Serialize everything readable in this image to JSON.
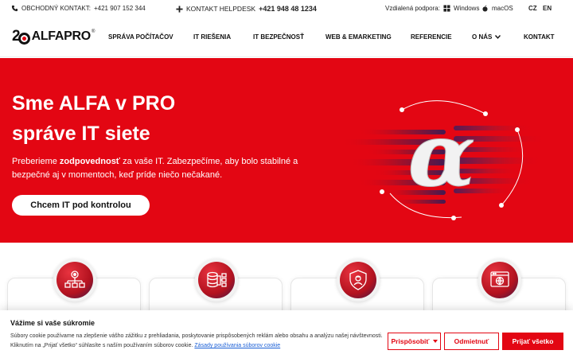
{
  "topbar": {
    "sales_label": "OBCHODNÝ KONTAKT:",
    "sales_phone": "+421 907 152 344",
    "helpdesk_label": "KONTAKT HELPDESK",
    "helpdesk_phone": "+421 948 48 1234",
    "remote_label": "Vzdialená podpora:",
    "windows": "Windows",
    "macos": "macOS",
    "lang_cz": "CZ",
    "lang_en": "EN"
  },
  "logo": {
    "number": "2",
    "brand": "ALFAPRO",
    "reg": "®"
  },
  "nav": {
    "items": [
      "SPRÁVA POČÍTAČOV",
      "IT RIEŠENIA",
      "IT BEZPEČNOSŤ",
      "WEB & EMARKETING",
      "REFERENCIE",
      "O NÁS",
      "KONTAKT"
    ]
  },
  "hero": {
    "title_line1": "Sme ALFA v PRO",
    "title_line2": "správe IT siete",
    "lead_pre": "Preberieme ",
    "lead_bold": "zodpovednosť",
    "lead_post": " za vaše IT. Zabezpečíme, aby bolo stabilné a bezpečné aj v momentoch, keď príde niečo nečakané.",
    "cta": "Chcem IT pod kontrolou",
    "alpha": "α"
  },
  "colors": {
    "brand_red": "#e30613",
    "link_blue": "#1a5fd6"
  },
  "cookie": {
    "title": "Vážime si vaše súkromie",
    "text": "Súbory cookie používame na zlepšenie vášho zážitku z prehliadania, poskytovanie prispôsobených reklám alebo obsahu a analýzu našej návštevnosti. Kliknutím na „Prijať všetko“ súhlasíte s naším používaním súborov cookie.",
    "link": "Zásady používania súborov cookie",
    "customize": "Prispôsobiť",
    "reject": "Odmietnuť",
    "accept": "Prijať všetko"
  }
}
